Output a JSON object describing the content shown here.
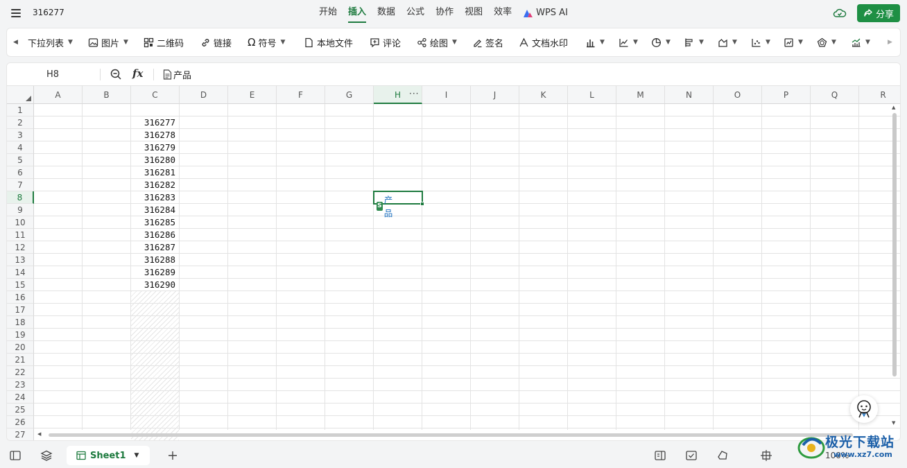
{
  "window": {
    "title": "316277"
  },
  "main_tabs": [
    "开始",
    "插入",
    "数据",
    "公式",
    "协作",
    "视图",
    "效率"
  ],
  "ai_tab": "WPS AI",
  "active_tab": "插入",
  "share_label": "分享",
  "toolbar": {
    "dropdown_list": "下拉列表",
    "picture": "图片",
    "qrcode": "二维码",
    "link": "链接",
    "symbol": "符号",
    "local_file": "本地文件",
    "comment": "评论",
    "drawing": "绘图",
    "signature": "签名",
    "watermark": "文档水印"
  },
  "formula_bar": {
    "name_box": "H8",
    "content": "产品"
  },
  "columns": [
    "A",
    "B",
    "C",
    "D",
    "E",
    "F",
    "G",
    "H",
    "I",
    "J",
    "K",
    "L",
    "M",
    "N",
    "O",
    "P",
    "Q",
    "R"
  ],
  "selected_column": "H",
  "rows": [
    "1",
    "2",
    "3",
    "4",
    "5",
    "6",
    "7",
    "8",
    "9",
    "10",
    "11",
    "12",
    "13",
    "14",
    "15",
    "16",
    "17",
    "18",
    "19",
    "20",
    "21",
    "22",
    "23",
    "24",
    "25",
    "26",
    "27"
  ],
  "selected_row": "8",
  "column_c_values": [
    "316277",
    "316278",
    "316279",
    "316280",
    "316281",
    "316282",
    "316283",
    "316284",
    "316285",
    "316286",
    "316287",
    "316288",
    "316289",
    "316290"
  ],
  "active_cell": {
    "badge": "S",
    "text": "产品"
  },
  "sheet_tab": "Sheet1",
  "zoom": "100%",
  "watermark": {
    "text": "极光下载站",
    "url": "www.xz7.com"
  },
  "colors": {
    "accent": "#1d7a3e",
    "share_bg": "#1e8f44",
    "link_blue": "#1a6fbf"
  }
}
